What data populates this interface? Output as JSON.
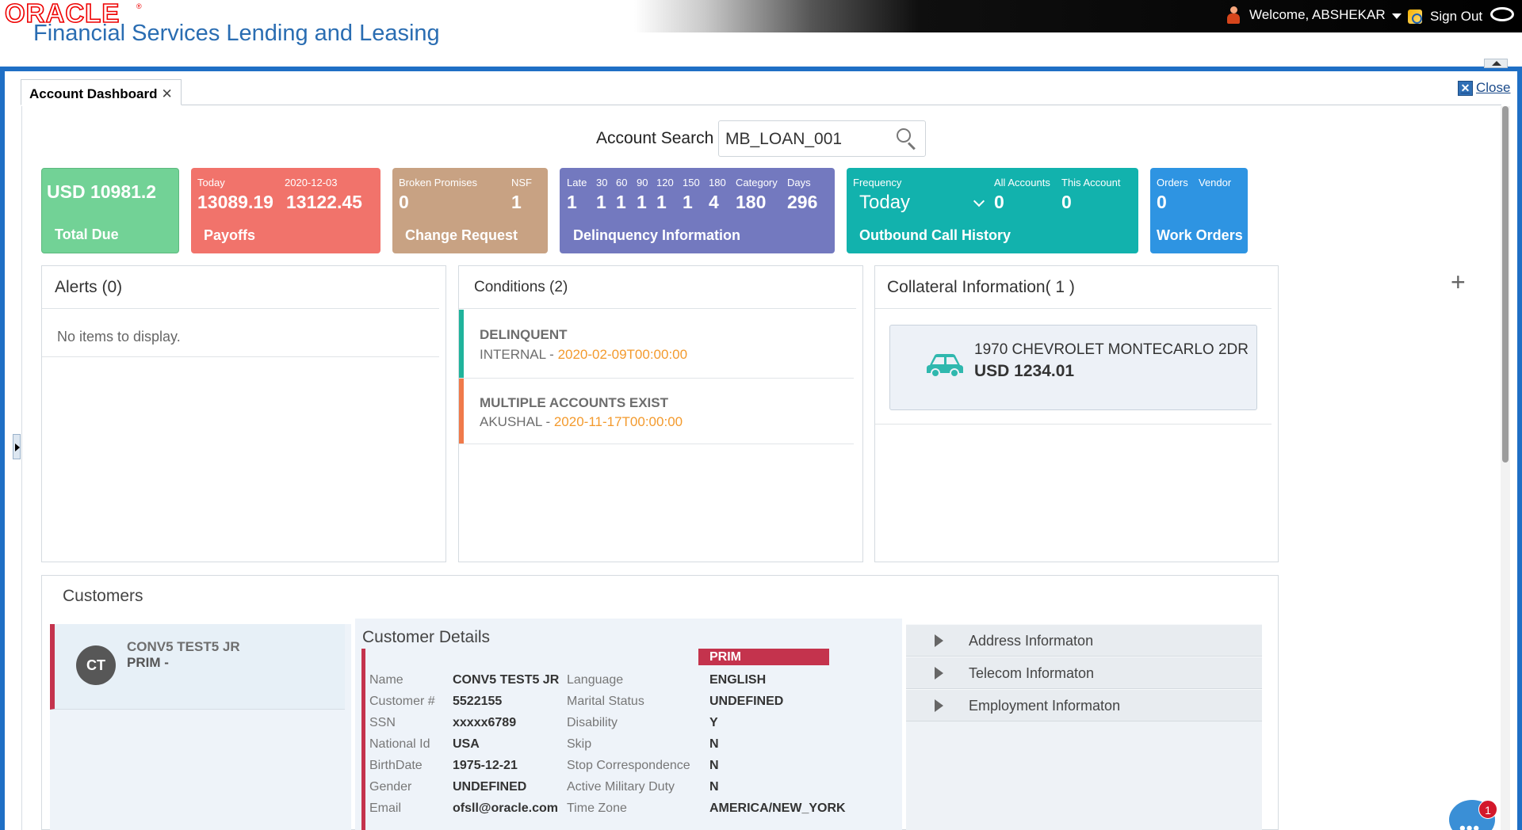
{
  "header": {
    "logo_text": "ORACLE",
    "logo_reg": "®",
    "product_name": "Financial Services Lending and Leasing",
    "welcome_text": "Welcome, ABSHEKAR",
    "sign_out_label": "Sign Out"
  },
  "tabs": [
    {
      "label": "Account Dashboard",
      "close_glyph": "✕"
    }
  ],
  "close_label": "Close",
  "search": {
    "label": "Account Search",
    "value": "MB_LOAN_001"
  },
  "tiles": {
    "total_due": {
      "amount": "USD 10981.2",
      "footer": "Total Due",
      "color": "#72d296"
    },
    "payoffs": {
      "today_label": "Today",
      "date_label": "2020-12-03",
      "today_value": "13089.19",
      "date_value": "13122.45",
      "footer": "Payoffs",
      "color": "#f1736b"
    },
    "change_request": {
      "broken_label": "Broken Promises",
      "nsf_label": "NSF",
      "broken_value": "0",
      "nsf_value": "1",
      "footer": "Change Request",
      "color": "#c8a283"
    },
    "delinquency": {
      "headers": [
        "Late",
        "30",
        "60",
        "90",
        "120",
        "150",
        "180",
        "Category",
        "Days"
      ],
      "values": [
        "1",
        "1",
        "1",
        "1",
        "1",
        "1",
        "4",
        "180",
        "296"
      ],
      "footer": "Delinquency Information",
      "color": "#7379bf"
    },
    "outbound": {
      "frequency_label": "Frequency",
      "frequency_value": "Today",
      "all_accounts_label": "All Accounts",
      "this_account_label": "This Account",
      "all_accounts_value": "0",
      "this_account_value": "0",
      "footer": "Outbound Call History",
      "color": "#12b2ad"
    },
    "work_orders": {
      "orders_label": "Orders",
      "vendor_label": "Vendor",
      "orders_value": "0",
      "footer": "Work Orders",
      "color": "#2e94e2"
    }
  },
  "alerts": {
    "title": "Alerts (0)",
    "empty_text": "No items to display."
  },
  "conditions": {
    "title": "Conditions (2)",
    "items": [
      {
        "name": "DELINQUENT",
        "source": "INTERNAL",
        "sep": " - ",
        "date": "2020-02-09T00:00:00",
        "color": "#1fb39b"
      },
      {
        "name": "MULTIPLE ACCOUNTS EXIST",
        "source": "AKUSHAL",
        "sep": " - ",
        "date": "2020-11-17T00:00:00",
        "color": "#f07a4a"
      }
    ]
  },
  "collateral": {
    "title": "Collateral Information( 1 )",
    "items": [
      {
        "icon": "car-icon",
        "description": "1970 CHEVROLET MONTECARLO 2DR",
        "value": "USD 1234.01"
      }
    ]
  },
  "add_glyph": "+",
  "customers": {
    "title": "Customers",
    "card": {
      "initials": "CT",
      "name": "CONV5 TEST5 JR",
      "role": "PRIM -"
    },
    "details": {
      "title": "Customer Details",
      "badge": "PRIM",
      "left": [
        {
          "label": "Name",
          "value": "CONV5 TEST5 JR"
        },
        {
          "label": "Customer #",
          "value": "5522155"
        },
        {
          "label": "SSN",
          "value": "xxxxx6789"
        },
        {
          "label": "National Id",
          "value": "USA"
        },
        {
          "label": "BirthDate",
          "value": "1975-12-21"
        },
        {
          "label": "Gender",
          "value": "UNDEFINED"
        },
        {
          "label": "Email",
          "value": "ofsll@oracle.com"
        }
      ],
      "right": [
        {
          "label": "Language",
          "value": "ENGLISH"
        },
        {
          "label": "Marital Status",
          "value": "UNDEFINED"
        },
        {
          "label": "Disability",
          "value": "Y"
        },
        {
          "label": "Skip",
          "value": "N"
        },
        {
          "label": "Stop Correspondence",
          "value": "N"
        },
        {
          "label": "Active Military Duty",
          "value": "N"
        },
        {
          "label": "Time Zone",
          "value": "AMERICA/NEW_YORK"
        }
      ]
    },
    "sections": [
      "Address Informaton",
      "Telecom Informaton",
      "Employment Informaton"
    ]
  },
  "chat": {
    "badge_count": "1",
    "dots": "•••"
  }
}
